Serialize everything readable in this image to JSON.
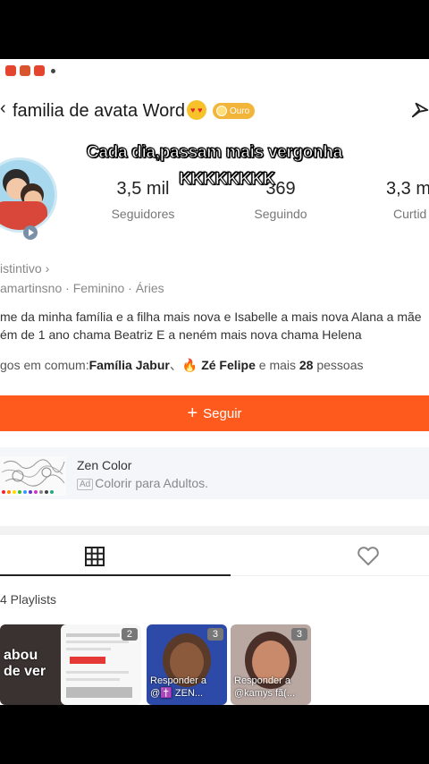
{
  "status_bar": {
    "icons": [
      "app-icon",
      "sync-icon",
      "app-icon",
      "dot"
    ]
  },
  "header": {
    "back": "‹",
    "title": "familia de avata Word",
    "badge": "Ouro"
  },
  "overlay_caption": {
    "line1": "Cada dia,passam mais vergonha",
    "line2": "KKKKKKKK"
  },
  "stats": [
    {
      "value": "3,5 mil",
      "label": "Seguidores"
    },
    {
      "value": "369",
      "label": "Seguindo"
    },
    {
      "value": "3,3 m",
      "label": "Curtid"
    }
  ],
  "profile": {
    "distintivo": "istintivo ›",
    "meta": "amartinsno · Feminino · Áries",
    "bio_line1": "me da minha família e a filha mais nova e Isabelle a mais nova Alana a mãe",
    "bio_line2": "ém de 1 ano chama Beatriz E a neném mais nova chama Helena",
    "mutual_prefix": "gos em comum:",
    "mutual_name1": "Família Jabur",
    "mutual_sep": "、",
    "mutual_name2": "Zé Felipe",
    "mutual_mid": " e mais ",
    "mutual_count": "28",
    "mutual_suffix": " pessoas"
  },
  "follow_button": {
    "label": "Seguir",
    "icon": "+"
  },
  "game": {
    "name": "Zen Color",
    "ad_tag": "Ad",
    "subtitle": "Colorir para Adultos."
  },
  "playlists": {
    "count_label": "4 Playlists"
  },
  "cards": [
    {
      "text": "abou de ver",
      "count": ""
    },
    {
      "text": "",
      "count": "2"
    },
    {
      "text": "Responder a @✝️ ZEN...",
      "count": "3"
    },
    {
      "text": "Responder a @kamys fã(...",
      "count": "3"
    }
  ],
  "colors": {
    "accent": "#fe5a1d",
    "badge": "#f3b43a"
  }
}
